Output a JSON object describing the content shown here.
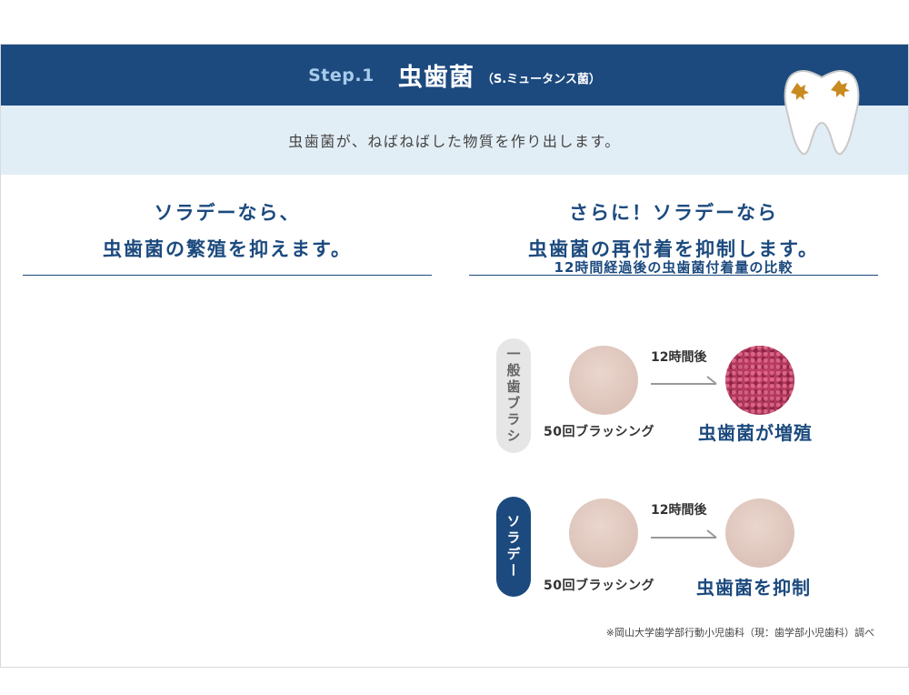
{
  "header": {
    "step": "Step.1",
    "title": "虫歯菌",
    "subtitle": "（S.ミュータンス菌）"
  },
  "description": "虫歯菌が、ねばねばした物質を作り出します。",
  "left": {
    "heading_line1": "ソラデーなら、",
    "heading_line2": "虫歯菌の繁殖を抑えます。"
  },
  "right": {
    "heading_line1": "さらに！ソラデーなら",
    "heading_line2": "虫歯菌の再付着を抑制します。",
    "comparison_title": "12時間経過後の虫歯菌付着量の比較",
    "rows": [
      {
        "group": "一般歯ブラシ",
        "after": "12時間後",
        "brushing": "50回ブラッシング",
        "result": "虫歯菌が増殖"
      },
      {
        "group": "ソラデー",
        "after": "12時間後",
        "brushing": "50回ブラッシング",
        "result": "虫歯菌を抑制"
      }
    ]
  },
  "footnote": "※岡山大学歯学部行動小児歯科（現：歯学部小児歯科）調べ",
  "colors": {
    "navy": "#1c4a7e",
    "light_blue_bg": "#e2eef6",
    "bacteria": "#b0385d"
  },
  "icons": [
    "tooth-icon",
    "arrow-right-icon"
  ]
}
